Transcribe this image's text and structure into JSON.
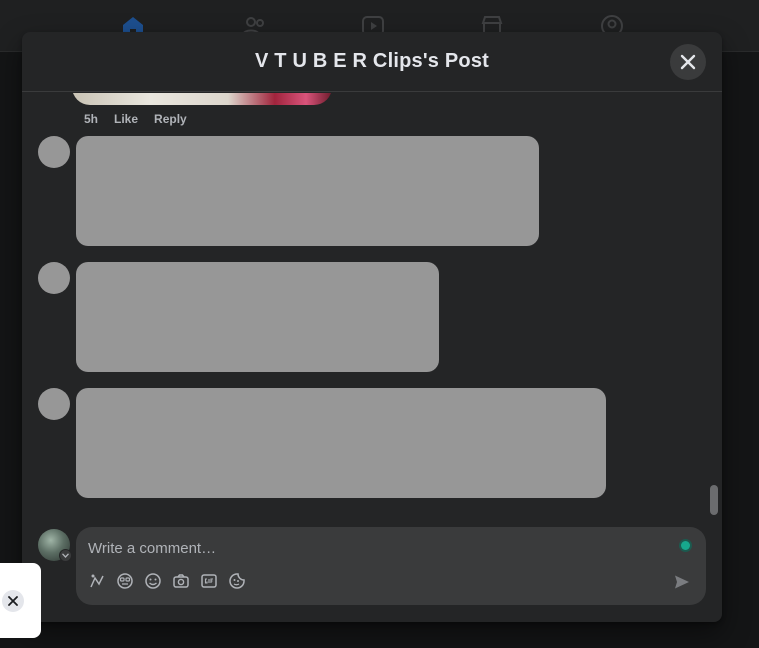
{
  "modal": {
    "title": "V T U B E R Clips's Post",
    "close_icon": "close-icon"
  },
  "comment": {
    "time": "5h",
    "like_label": "Like",
    "reply_label": "Reply"
  },
  "composer": {
    "placeholder": "Write a comment…",
    "tools": [
      "avatar-sticker-icon",
      "emoji-face-icon",
      "smiley-icon",
      "camera-icon",
      "gif-icon",
      "sticker-icon"
    ],
    "send_icon": "send-icon"
  },
  "nav": {
    "icons": [
      "home-icon",
      "friends-icon",
      "video-icon",
      "marketplace-icon",
      "groups-icon"
    ],
    "active_color": "#2d88ff"
  },
  "colors": {
    "modal_bg": "#242526",
    "skeleton": "#979797",
    "status_dot": "#17a88d"
  }
}
